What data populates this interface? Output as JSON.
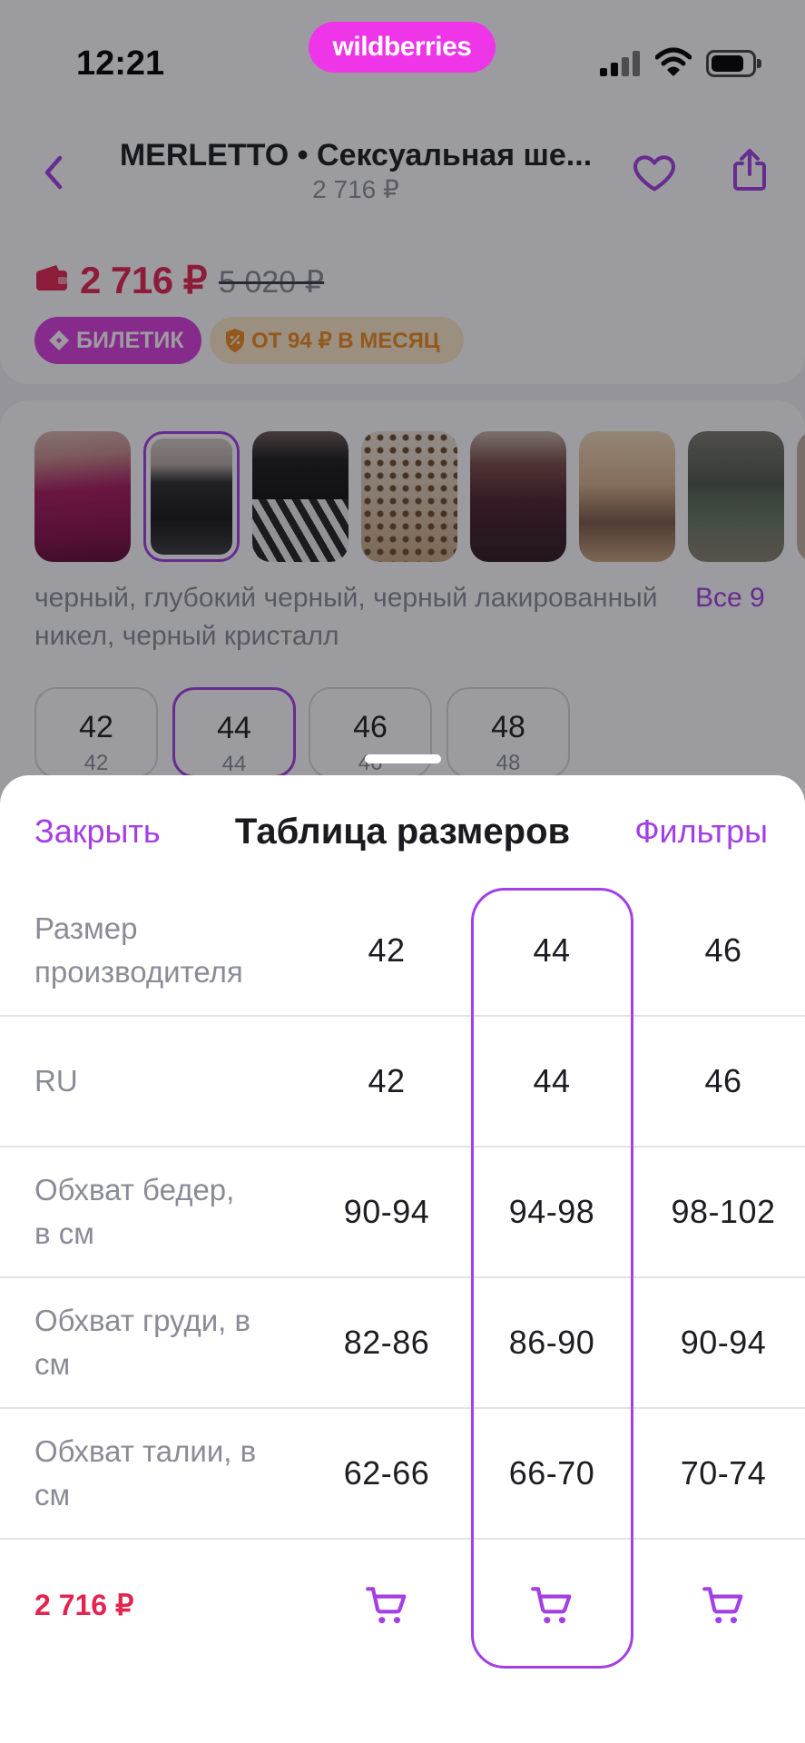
{
  "status_bar": {
    "time": "12:21",
    "logo": "wildberries",
    "battery_level": 0.82
  },
  "header": {
    "title": "MERLETTO • Сексуальная ше...",
    "price": "2 716 ₽"
  },
  "price_block": {
    "current": "2 716 ₽",
    "old": "5 020 ₽",
    "badges": [
      {
        "label": "БИЛЕТИК"
      },
      {
        "label": "ОТ 94 ₽ В МЕСЯЦ"
      }
    ]
  },
  "variants": {
    "selected_index": 1,
    "colors_text": "черный, глубокий черный, черный лакированный\nникел, черный кристалл",
    "all_link": "Все 9"
  },
  "size_chips": {
    "selected_index": 1,
    "items": [
      {
        "size": "42",
        "ru": "42"
      },
      {
        "size": "44",
        "ru": "44"
      },
      {
        "size": "46",
        "ru": "46"
      },
      {
        "size": "48",
        "ru": "48"
      }
    ]
  },
  "sheet": {
    "close_label": "Закрыть",
    "title": "Таблица размеров",
    "filters_label": "Фильтры",
    "selected_column_index": 1,
    "rows": [
      {
        "label": "Размер\nпроизводителя",
        "values": [
          "42",
          "44",
          "46"
        ]
      },
      {
        "label": "RU",
        "values": [
          "42",
          "44",
          "46"
        ]
      },
      {
        "label": "Обхват бедер,\nв см",
        "values": [
          "90-94",
          "94-98",
          "98-102"
        ]
      },
      {
        "label": "Обхват груди, в\nсм",
        "values": [
          "82-86",
          "86-90",
          "90-94"
        ]
      },
      {
        "label": "Обхват талии, в\nсм",
        "values": [
          "62-66",
          "66-70",
          "70-74"
        ]
      }
    ],
    "footer": {
      "price": "2 716 ₽"
    }
  },
  "colors": {
    "accent": "#a43fe3",
    "price_red": "#e3244f",
    "brand": "#ee36e8"
  }
}
